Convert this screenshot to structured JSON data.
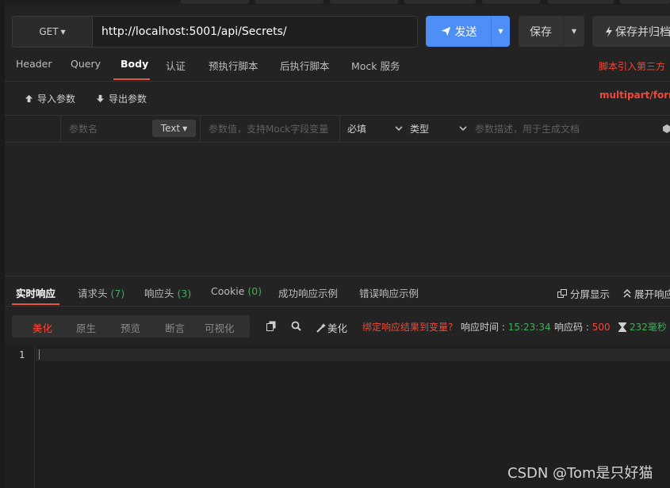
{
  "request": {
    "method": "GET",
    "url": "http://localhost:5001/api/Secrets/",
    "send_label": "发送",
    "save_label": "保存",
    "save_archive_label": "保存并归档"
  },
  "request_tabs": {
    "header": "Header",
    "query": "Query",
    "body": "Body",
    "auth": "认证",
    "pre_script": "预执行脚本",
    "post_script": "后执行脚本",
    "mock": "Mock 服务"
  },
  "script_note": "脚本引入第三方",
  "body_toolbar": {
    "import": "导入参数",
    "export": "导出参数",
    "content_type": "multipart/form-d"
  },
  "param_row": {
    "name_placeholder": "参数名",
    "type_select": "Text",
    "value_placeholder": "参数值，支持Mock字段变量",
    "required": "必填",
    "type_label": "类型",
    "desc_placeholder": "参数描述，用于生成文档"
  },
  "response_tabs": {
    "realtime": "实时响应",
    "req_headers": "请求头",
    "req_headers_count": "(7)",
    "res_headers": "响应头",
    "res_headers_count": "(3)",
    "cookie": "Cookie",
    "cookie_count": "(0)",
    "success_example": "成功响应示例",
    "error_example": "错误响应示例",
    "split_view": "分屏显示",
    "expand": "展开响应"
  },
  "view_modes": [
    "美化",
    "原生",
    "预览",
    "断言",
    "可视化"
  ],
  "response_toolbar": {
    "beautify": "美化",
    "bind_var": "绑定响应结果到变量?",
    "time_label": "响应时间 :",
    "time_value": "15:23:34",
    "code_label": "响应码 :",
    "code_value": "500",
    "duration": "232毫秒"
  },
  "editor": {
    "line_number": "1"
  },
  "watermark": "CSDN @Tom是只好猫",
  "colors": {
    "accent": "#4e8ef7",
    "danger": "#f0493a",
    "success": "#3fae5a",
    "tab_underline": "#e6553f"
  }
}
